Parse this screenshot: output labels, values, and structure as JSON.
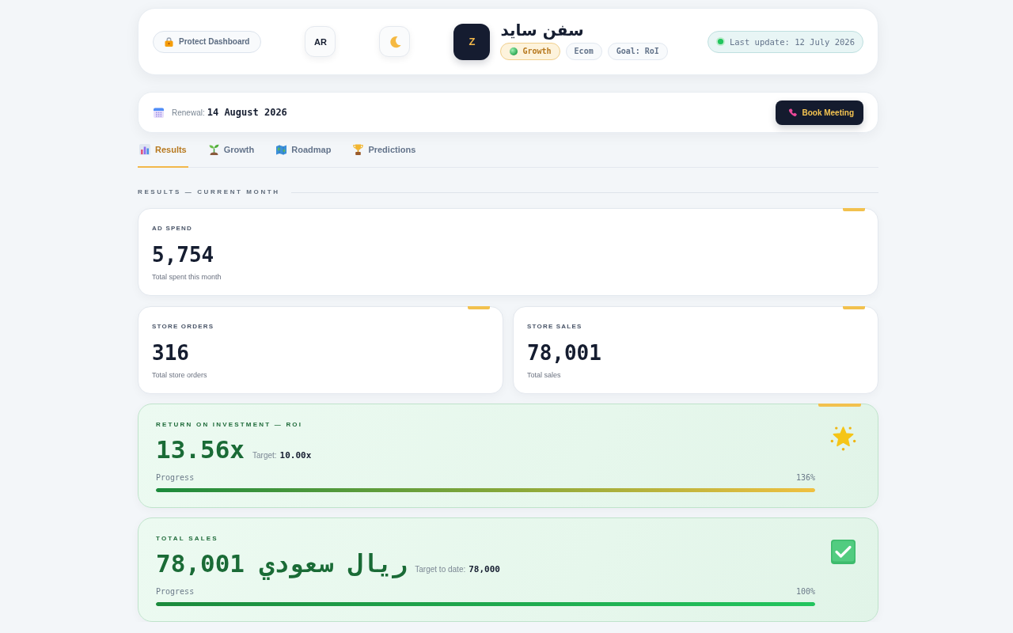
{
  "header": {
    "protect_button": "Protect Dashboard",
    "language_button": "AR",
    "profile": {
      "avatar_letter": "Z",
      "name": "سفن سايد",
      "tags": [
        {
          "label": "Growth",
          "kind": "status"
        },
        {
          "label": "Ecom",
          "kind": "plain"
        },
        {
          "label": "Goal: RoI",
          "kind": "plain"
        }
      ]
    },
    "last_update": "Last update: 12 July 2026"
  },
  "renewal_bar": {
    "label": "Renewal:",
    "date": "14 August 2026",
    "book_button": "Book Meeting"
  },
  "tabs": [
    {
      "label": "Results",
      "selected": true
    },
    {
      "label": "Growth",
      "selected": false
    },
    {
      "label": "Roadmap",
      "selected": false
    },
    {
      "label": "Predictions",
      "selected": false
    }
  ],
  "section_title": "RESULTS — CURRENT MONTH",
  "stat_cards": [
    {
      "label": "AD SPEND",
      "value": "5,754",
      "caption": "Total spent this month"
    },
    {
      "label": "STORE ORDERS",
      "value": "316",
      "caption": "Total store orders"
    },
    {
      "label": "STORE SALES",
      "value": "78,001",
      "caption": "Total sales"
    }
  ],
  "goal_cards": [
    {
      "kind": "roi",
      "label": "RETURN ON INVESTMENT — ROI",
      "value": "13.56x",
      "target_label": "Target:",
      "target_value": "10.00x",
      "progress_label": "Progress",
      "reading": "136%",
      "level": 1
    },
    {
      "kind": "sales",
      "label": "TOTAL SALES",
      "value": "78,001 ريال سعودي",
      "target_label": "Target to date:",
      "target_value": "78,000",
      "progress_label": "Progress",
      "reading": "100%",
      "level": 1
    }
  ]
}
